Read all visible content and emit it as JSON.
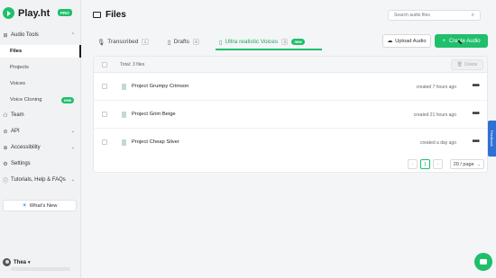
{
  "brand": {
    "name": "Play.ht",
    "badge": "PRO"
  },
  "sidebar": {
    "sections": [
      {
        "label": "Audio Tools",
        "expanded": true,
        "items": [
          {
            "label": "Files",
            "active": true
          },
          {
            "label": "Projects"
          },
          {
            "label": "Voices"
          },
          {
            "label": "Voice Cloning",
            "badge": "new"
          }
        ]
      },
      {
        "label": "Team"
      },
      {
        "label": "API"
      },
      {
        "label": "Accessibility"
      },
      {
        "label": "Settings"
      },
      {
        "label": "Tutorials, Help & FAQs"
      }
    ],
    "whats_new": "What's New",
    "user": "Thea"
  },
  "header": {
    "title": "Files",
    "search_placeholder": "Search audio files"
  },
  "tabs": [
    {
      "label": "Transcribed",
      "count": "1"
    },
    {
      "label": "Drafts",
      "count": "5"
    },
    {
      "label": "Ultra realistic Voices",
      "count": "3",
      "badge": "new",
      "active": true
    }
  ],
  "actions": {
    "upload": "Upload Audio",
    "create": "Create Audio"
  },
  "table": {
    "total": "Total: 3 files",
    "delete": "Delete",
    "rows": [
      {
        "name": "Project Grumpy Crimson",
        "created": "created 7 hours ago"
      },
      {
        "name": "Project Grim Beige",
        "created": "created 21 hours ago"
      },
      {
        "name": "Project Cheap Silver",
        "created": "created a day ago"
      }
    ]
  },
  "pagination": {
    "current": "1",
    "prev": "‹",
    "next": "›",
    "page_size": "20 / page"
  },
  "feedback": "Feedback",
  "colors": {
    "accent": "#1fbf6b",
    "feedback": "#2f6fd8"
  }
}
